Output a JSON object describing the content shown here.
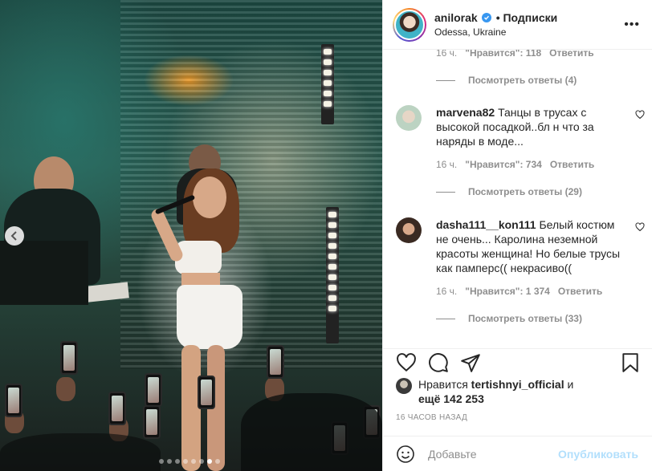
{
  "post": {
    "username": "anilorak",
    "follow_label": "• Подписки",
    "location": "Odessa, Ukraine",
    "more_icon": "more-horizontal-icon"
  },
  "comments": {
    "top_partial": {
      "time": "16 ч.",
      "likes": "\"Нравится\": 118",
      "reply": "Ответить"
    },
    "top_view_replies": "Посмотреть ответы (4)",
    "items": [
      {
        "user": "marvena82",
        "text": "Танцы в трусах с высокой посадкой..бл н что за наряды в моде...",
        "time": "16 ч.",
        "likes": "\"Нравится\": 734",
        "reply": "Ответить",
        "view_replies": "Посмотреть ответы (29)"
      },
      {
        "user": "dasha111__kon111",
        "text": "Белый костюм не очень... Каролина неземной красоты женщина! Но белые трусы как памперс(( некрасиво((",
        "time": "16 ч.",
        "likes": "\"Нравится\": 1 374",
        "reply": "Ответить",
        "view_replies": "Посмотреть ответы (33)"
      }
    ]
  },
  "likes": {
    "prefix": "Нравится",
    "user": "tertishnyi_official",
    "and": "и",
    "count_text": "ещё 142 253"
  },
  "timestamp": "16 ЧАСОВ НАЗАД",
  "add_comment": {
    "placeholder": "Добавьте",
    "publish_label": "Опубликовать"
  },
  "carousel": {
    "total_dots": 8,
    "active_index": 6
  },
  "colors": {
    "verified": "#3897f0",
    "publish": "#b2dffc",
    "muted": "#8e8e8e"
  }
}
